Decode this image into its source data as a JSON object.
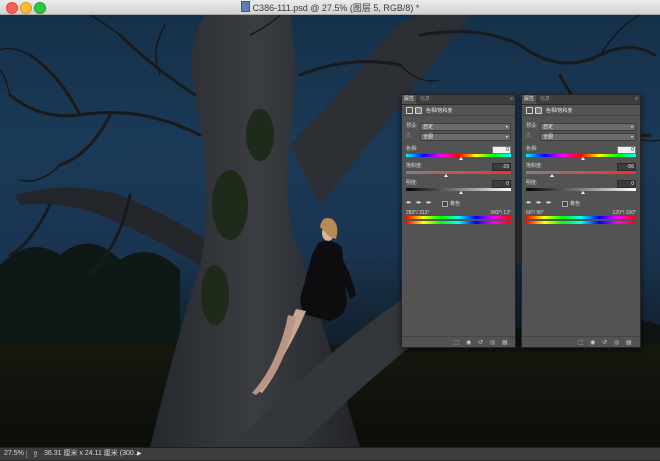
{
  "window": {
    "title": "C386-111.psd @ 27.5% (图层 5, RGB/8) *",
    "controls": [
      "close",
      "minimize",
      "maximize"
    ]
  },
  "status_bar": {
    "zoom": "27.5%",
    "doc_info": "36.31 厘米 x 24.11 厘米 (300...",
    "arrow_icon": "triangle-right-icon"
  },
  "panels": [
    {
      "id": "left",
      "tabs": [
        "属性",
        "信息"
      ],
      "header_title": "色相/饱和度",
      "preset_label": "预设:",
      "preset_value": "自定",
      "channel_value": "全图",
      "hue_label": "色相:",
      "hue_value": "0",
      "saturation_label": "饱和度:",
      "saturation_value": "-29",
      "saturation_pct": 0.36,
      "lightness_label": "明度:",
      "lightness_value": "0",
      "colorize_label": "着色",
      "range_left": "283°/ 313°",
      "range_right": "343°\\ 13°"
    },
    {
      "id": "right",
      "tabs": [
        "属性",
        "信息"
      ],
      "header_title": "色相/饱和度",
      "preset_label": "预设:",
      "preset_value": "自定",
      "channel_value": "全图",
      "hue_label": "色相:",
      "hue_value": "0",
      "saturation_label": "饱和度:",
      "saturation_value": "-56",
      "saturation_pct": 0.22,
      "lightness_label": "明度:",
      "lightness_value": "0",
      "colorize_label": "着色",
      "range_left": "60°/ 90°",
      "range_right": "120°\\ 150°"
    }
  ]
}
